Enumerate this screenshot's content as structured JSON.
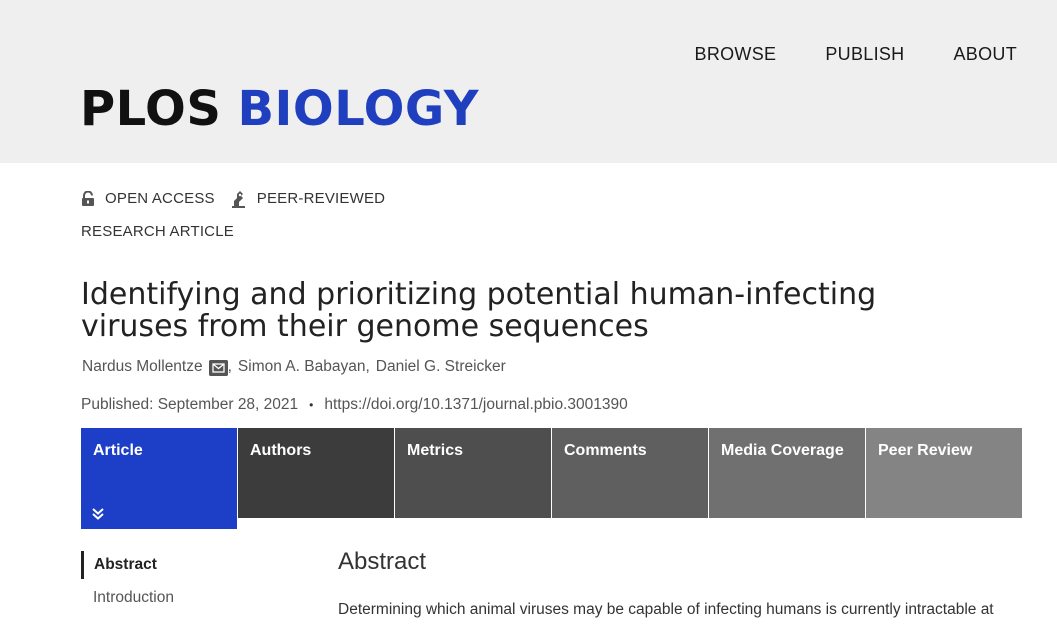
{
  "topnav": {
    "items": [
      {
        "label": "BROWSE"
      },
      {
        "label": "PUBLISH"
      },
      {
        "label": "ABOUT"
      }
    ]
  },
  "logo": {
    "part1": "PLOS",
    "part2": "BIOLOGY",
    "color_primary": "#111111",
    "color_accent": "#1f3fbf"
  },
  "badges": {
    "open_access": {
      "label": "OPEN ACCESS",
      "icon": "open-lock-icon"
    },
    "peer_reviewed": {
      "label": "PEER-REVIEWED",
      "icon": "peer-review-icon"
    }
  },
  "article_type": "RESEARCH ARTICLE",
  "title": "Identifying and prioritizing potential human-infecting viruses from their genome sequences",
  "authors": {
    "list": [
      {
        "name": "Nardus Mollentze",
        "has_email": true
      },
      {
        "name": "Simon A. Babayan"
      },
      {
        "name": "Daniel G. Streicker"
      }
    ],
    "separator": ","
  },
  "published": {
    "label": "Published: September 28, 2021",
    "bullet": "•",
    "doi": "https://doi.org/10.1371/journal.pbio.3001390"
  },
  "tabs": {
    "items": [
      {
        "label": "Article",
        "active": true,
        "color": "#1d3ec6"
      },
      {
        "label": "Authors",
        "color": "#3c3c3c"
      },
      {
        "label": "Metrics",
        "color": "#4e4e4e"
      },
      {
        "label": "Comments",
        "color": "#5f5f5f"
      },
      {
        "label": "Media Coverage",
        "color": "#707070"
      },
      {
        "label": "Peer Review",
        "color": "#848484"
      }
    ]
  },
  "sidenav": {
    "items": [
      {
        "label": "Abstract",
        "active": true
      },
      {
        "label": "Introduction"
      }
    ]
  },
  "abstract": {
    "heading": "Abstract",
    "text": "Determining which animal viruses may be capable of infecting humans is currently intractable at"
  }
}
